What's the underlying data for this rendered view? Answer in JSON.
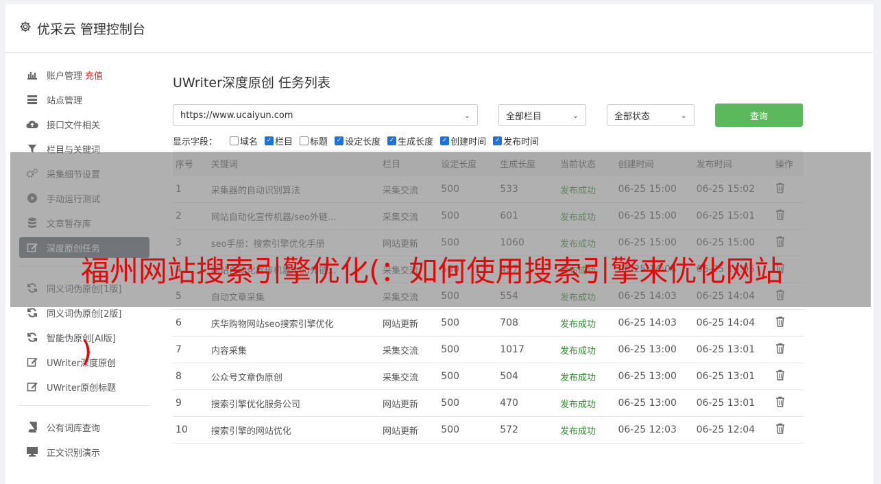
{
  "header": {
    "title": "优采云 管理控制台"
  },
  "sidebar": {
    "items": [
      {
        "label": "账户管理",
        "extra": "充值",
        "icon": "bar-chart-icon"
      },
      {
        "label": "站点管理",
        "icon": "server-icon"
      },
      {
        "label": "接口文件相关",
        "icon": "cloud-upload-icon"
      },
      {
        "label": "栏目与关键词",
        "icon": "filter-icon"
      },
      {
        "label": "采集细节设置",
        "icon": "gears-icon"
      },
      {
        "label": "手动运行测试",
        "icon": "play-icon"
      },
      {
        "label": "文章暂存库",
        "icon": "database-icon"
      },
      {
        "label": "深度原创任务",
        "icon": "edit-icon"
      },
      {
        "label": "同义词伪原创[1版]",
        "icon": "refresh-icon"
      },
      {
        "label": "同义词伪原创[2版]",
        "icon": "refresh-icon"
      },
      {
        "label": "智能伪原创[AI版]",
        "icon": "refresh-icon"
      },
      {
        "label": "UWriter深度原创",
        "icon": "edit-icon"
      },
      {
        "label": "UWriter原创标题",
        "icon": "edit-icon"
      },
      {
        "label": "公有词库查询",
        "icon": "book-icon"
      },
      {
        "label": "正文识别演示",
        "icon": "monitor-icon"
      }
    ]
  },
  "main": {
    "title": "UWriter深度原创 任务列表",
    "site_select": "https://www.ucaiyun.com",
    "category_select": "全部栏目",
    "status_select": "全部状态",
    "query_button": "查询",
    "fields_label": "显示字段：",
    "fields": [
      {
        "label": "域名",
        "checked": false
      },
      {
        "label": "栏目",
        "checked": true
      },
      {
        "label": "标题",
        "checked": false
      },
      {
        "label": "设定长度",
        "checked": true
      },
      {
        "label": "生成长度",
        "checked": true
      },
      {
        "label": "创建时间",
        "checked": true
      },
      {
        "label": "发布时间",
        "checked": true
      }
    ],
    "table": {
      "headers": [
        "序号",
        "关键词",
        "栏目",
        "设定长度",
        "生成长度",
        "当前状态",
        "创建时间",
        "发布时间",
        "操作"
      ],
      "rows": [
        [
          "1",
          "采集器的自动识别算法",
          "采集交流",
          "500",
          "533",
          "发布成功",
          "06-25 15:00",
          "06-25 15:02"
        ],
        [
          "2",
          "网站自动化宣传机器/seo外链...",
          "采集交流",
          "500",
          "601",
          "发布成功",
          "06-25 15:00",
          "06-25 15:01"
        ],
        [
          "3",
          "seo手册：搜索引擎优化手册",
          "网站更新",
          "500",
          "1060",
          "发布成功",
          "06-25 15:00",
          "06-25 15:00"
        ],
        [
          "4",
          "网站自动化宣传机器/seo外链...",
          "采集交流",
          "500",
          "497",
          "发布成功",
          "06-25 14:04",
          "06-25 14:05"
        ],
        [
          "5",
          "自动文章采集",
          "采集交流",
          "500",
          "554",
          "发布成功",
          "06-25 14:03",
          "06-25 14:04"
        ],
        [
          "6",
          "庆华购物网站seo搜索引擎优化",
          "网站更新",
          "500",
          "708",
          "发布成功",
          "06-25 14:03",
          "06-25 14:04"
        ],
        [
          "7",
          "内容采集",
          "采集交流",
          "500",
          "1017",
          "发布成功",
          "06-25 13:00",
          "06-25 13:01"
        ],
        [
          "8",
          "公众号文章伪原创",
          "采集交流",
          "500",
          "504",
          "发布成功",
          "06-25 13:00",
          "06-25 13:01"
        ],
        [
          "9",
          "搜索引擎优化服务公司",
          "网站更新",
          "500",
          "470",
          "发布成功",
          "06-25 13:00",
          "06-25 13:01"
        ],
        [
          "10",
          "搜索引擎的网站优化",
          "网站更新",
          "500",
          "572",
          "发布成功",
          "06-25 12:03",
          "06-25 12:04"
        ]
      ]
    }
  },
  "overlay": {
    "line1": "福州网站搜索引擎优化(：如何使用搜索引擎来优化网站",
    "line2": ")"
  },
  "colors": {
    "accent_green": "#5cb85c",
    "active_nav": "#5a6170",
    "success": "#2a8c2a",
    "overlay_text": "#e10a0a"
  }
}
